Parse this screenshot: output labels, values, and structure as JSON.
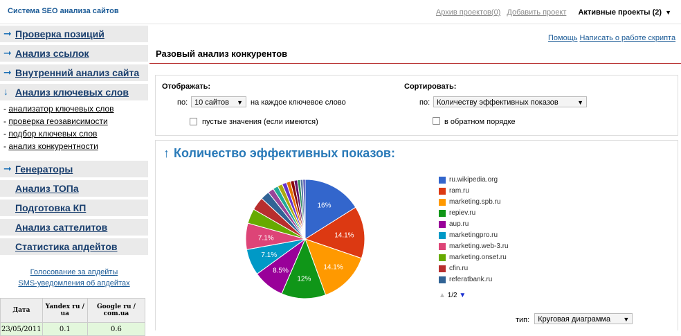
{
  "header": {
    "logo": "Система SEO анализа сайтов",
    "archive": "Архив проектов(0)",
    "add_project": "Добавить проект",
    "active_projects": "Активные проекты (2)"
  },
  "sidebar": {
    "sections": [
      {
        "label": "Проверка позиций",
        "icon": "arrow-right-icon"
      },
      {
        "label": "Анализ ссылок",
        "icon": "arrow-right-icon"
      },
      {
        "label": "Внутренний анализ сайта",
        "icon": "arrow-right-icon"
      },
      {
        "label": "Анализ ключевых слов",
        "icon": "arrow-down-icon"
      }
    ],
    "subitems": [
      "анализатор ключевых слов",
      "проверка геозависимости",
      "подбор ключевых слов",
      "анализ конкурентности"
    ],
    "generators": {
      "label": "Генераторы",
      "icon": "arrow-right-icon"
    },
    "plain_items": [
      "Анализ ТОПа",
      "Подготовка КП",
      "Анализ саттелитов",
      "Статистика апдейтов"
    ],
    "vote_link": "Голосование за апдейты",
    "sms_link": "SMS-уведомления об апдейтах",
    "stats_table": {
      "headers": [
        "Дата",
        "Yandex ru / ua",
        "Google ru / com.ua"
      ],
      "rows": [
        [
          "23/05/2011",
          "0.1",
          "0.6"
        ]
      ]
    }
  },
  "main": {
    "help": "Помощь",
    "write": "Написать о работе скрипта",
    "title": "Разовый анализ конкурентов",
    "display_label": "Отображать:",
    "display_by": "по:",
    "display_value": "10 сайтов",
    "display_suffix": "на каждое ключевое слово",
    "empty_values": "пустые значения (если имеются)",
    "sort_label": "Сортировать:",
    "sort_by": "по:",
    "sort_value": "Количеству эффективных показов",
    "reverse": "в обратном порядке",
    "chart_title": "Количество эффективных показов:",
    "pager": "1/2",
    "type_label": "тип:",
    "type_value": "Круговая диаграмма"
  },
  "chart_data": {
    "type": "pie",
    "title": "Количество эффективных показов:",
    "slices": [
      {
        "label": "ru.wikipedia.org",
        "value": 16,
        "color": "#3366cc"
      },
      {
        "label": "ram.ru",
        "value": 14.1,
        "color": "#dc3912"
      },
      {
        "label": "marketing.spb.ru",
        "value": 14.1,
        "color": "#ff9900"
      },
      {
        "label": "repiev.ru",
        "value": 12,
        "color": "#109618"
      },
      {
        "label": "aup.ru",
        "value": 8.5,
        "color": "#990099"
      },
      {
        "label": "marketingpro.ru",
        "value": 7.1,
        "color": "#0099c6"
      },
      {
        "label": "marketing.web-3.ru",
        "value": 7.1,
        "color": "#dd4477"
      },
      {
        "label": "marketing.onset.ru",
        "value": 4.0,
        "color": "#66aa00"
      },
      {
        "label": "cfin.ru",
        "value": 3.6,
        "color": "#b82e2e"
      },
      {
        "label": "referatbank.ru",
        "value": 2.4,
        "color": "#316395"
      },
      {
        "label": "",
        "value": 1.6,
        "color": "#994499"
      },
      {
        "label": "",
        "value": 1.4,
        "color": "#22aa99"
      },
      {
        "label": "",
        "value": 1.3,
        "color": "#aaaa11"
      },
      {
        "label": "",
        "value": 1.2,
        "color": "#6633cc"
      },
      {
        "label": "",
        "value": 1.1,
        "color": "#e67300"
      },
      {
        "label": "",
        "value": 1.0,
        "color": "#8b0707"
      },
      {
        "label": "",
        "value": 0.9,
        "color": "#651067"
      },
      {
        "label": "",
        "value": 0.8,
        "color": "#329262"
      },
      {
        "label": "",
        "value": 0.7,
        "color": "#5574a6"
      },
      {
        "label": "",
        "value": 0.6,
        "color": "#3b3eac"
      }
    ],
    "data_labels": [
      "16%",
      "14.1%",
      "14.1%",
      "12%",
      "8.5%",
      "7.1%",
      "7.1%"
    ]
  }
}
